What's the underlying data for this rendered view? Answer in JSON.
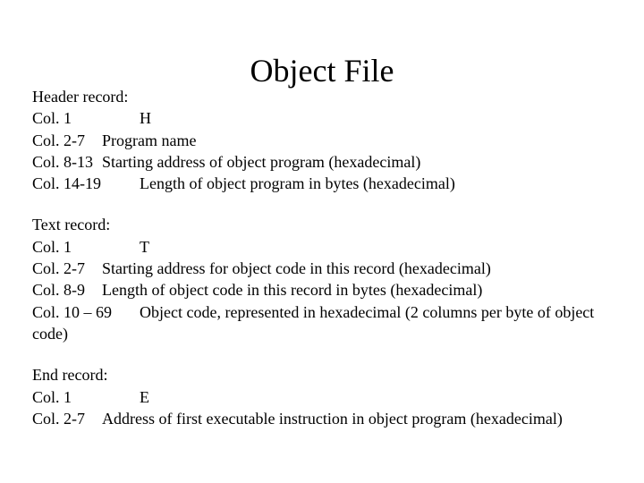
{
  "title": "Object File",
  "header": {
    "label": "Header record:",
    "rows": [
      {
        "col": "Col. 1",
        "desc": "H",
        "wide": true
      },
      {
        "col": "Col. 2-7",
        "desc": "Program name"
      },
      {
        "col": "Col. 8-13",
        "desc": "Starting address of object program (hexadecimal)"
      },
      {
        "col": "Col. 14-19",
        "desc": "Length of object program in bytes (hexadecimal)",
        "wide": true
      }
    ]
  },
  "text": {
    "label": "Text record:",
    "rows": [
      {
        "col": "Col. 1",
        "desc": "T",
        "wide": true
      },
      {
        "col": "Col. 2-7",
        "desc": "Starting address for object code in this record (hexadecimal)"
      },
      {
        "col": "Col. 8-9",
        "desc": "Length of object code in this record in bytes (hexadecimal)"
      },
      {
        "col": "Col. 10 – 69",
        "desc": "Object code, represented in hexadecimal (2 columns per byte of object code)",
        "wide": true
      }
    ]
  },
  "end": {
    "label": "End record:",
    "rows": [
      {
        "col": "Col. 1",
        "desc": "E",
        "wide": true
      },
      {
        "col": "Col. 2-7",
        "desc": "Address of first executable instruction in object program (hexadecimal)"
      }
    ]
  }
}
